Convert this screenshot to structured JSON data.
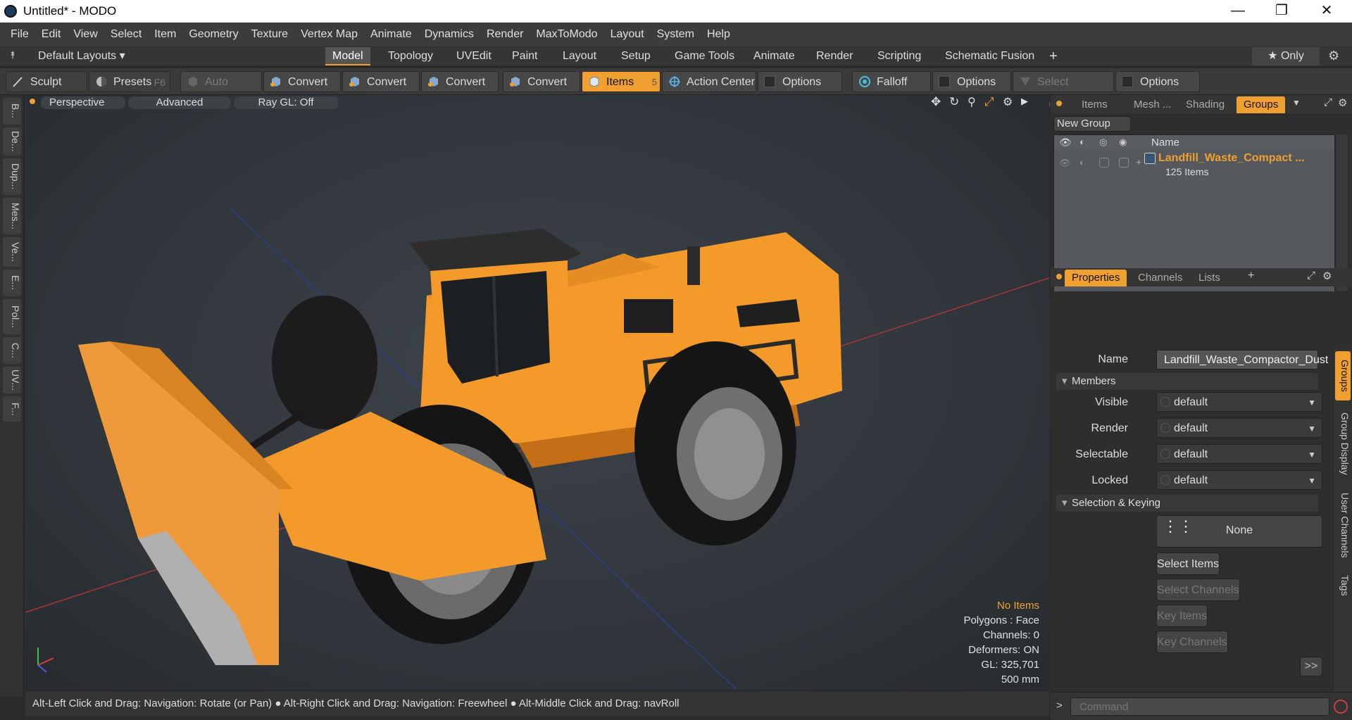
{
  "window": {
    "title": "Untitled* - MODO",
    "minimize": "—",
    "maximize": "❐",
    "close": "✕"
  },
  "menu": [
    "File",
    "Edit",
    "View",
    "Select",
    "Item",
    "Geometry",
    "Texture",
    "Vertex Map",
    "Animate",
    "Dynamics",
    "Render",
    "MaxToModo",
    "Layout",
    "System",
    "Help"
  ],
  "layout_bar": {
    "layouts_label": "Default Layouts ▾",
    "tabs": [
      "Model",
      "Topology",
      "UVEdit",
      "Paint",
      "Layout",
      "Setup",
      "Game Tools",
      "Animate",
      "Render",
      "Scripting",
      "Schematic Fusion"
    ],
    "active_tab": "Model",
    "add": "+",
    "only_label": "★  Only"
  },
  "toolbar": {
    "sculpt": "Sculpt",
    "presets": "Presets",
    "presets_key": "F6",
    "auto_select": "Auto Select",
    "convert1": "Convert",
    "convert2": "Convert",
    "convert3": "Convert",
    "convert4": "Convert",
    "items": "Items",
    "items_key": "5",
    "action_center": "Action Center",
    "options1": "Options",
    "falloff": "Falloff",
    "options2": "Options",
    "select_through": "Select Through",
    "options3": "Options"
  },
  "left_tabs": [
    "B...",
    "De...",
    "Dup...",
    "Mes...",
    "Ve...",
    "E...",
    "Pol...",
    "C...",
    "UV...",
    "F..."
  ],
  "viewport": {
    "view": "Perspective",
    "shading": "Advanced",
    "raygl": "Ray GL: Off",
    "info": {
      "items": "No Items",
      "polygons": "Polygons : Face",
      "channels": "Channels: 0",
      "deformers": "Deformers: ON",
      "gl": "GL: 325,701",
      "scale": "500 mm"
    }
  },
  "status": "Alt-Left Click and Drag: Navigation: Rotate (or Pan) ● Alt-Right Click and Drag: Navigation: Freewheel ● Alt-Middle Click and Drag: navRoll",
  "groups_panel": {
    "tabs": [
      "Items",
      "Mesh ...",
      "Shading",
      "Groups"
    ],
    "active_tab": "Groups",
    "new_group": "New Group",
    "col_name": "Name",
    "group_name": "Landfill_Waste_Compact ...",
    "group_count": "125 Items"
  },
  "properties": {
    "tabs": [
      "Properties",
      "Channels",
      "Lists"
    ],
    "active_tab": "Properties",
    "add": "+",
    "name_label": "Name",
    "name_value": "Landfill_Waste_Compactor_Dust",
    "members_header": "Members",
    "fields": [
      {
        "label": "Visible",
        "value": "default"
      },
      {
        "label": "Render",
        "value": "default"
      },
      {
        "label": "Selectable",
        "value": "default"
      },
      {
        "label": "Locked",
        "value": "default"
      }
    ],
    "selection_header": "Selection & Keying",
    "none": "None",
    "select_items": "Select Items",
    "select_channels": "Select Channels",
    "key_items": "Key Items",
    "key_channels": "Key Channels",
    "more": ">>"
  },
  "side_tabs": [
    "Groups",
    "Group Display",
    "User Channels",
    "Tags"
  ],
  "command": {
    "placeholder": "Command",
    "prompt": ">"
  },
  "colors": {
    "accent": "#f0a030",
    "machine": "#f39a2a",
    "grid_red": "#b03a3a",
    "grid_blue": "#2a3f8a"
  }
}
